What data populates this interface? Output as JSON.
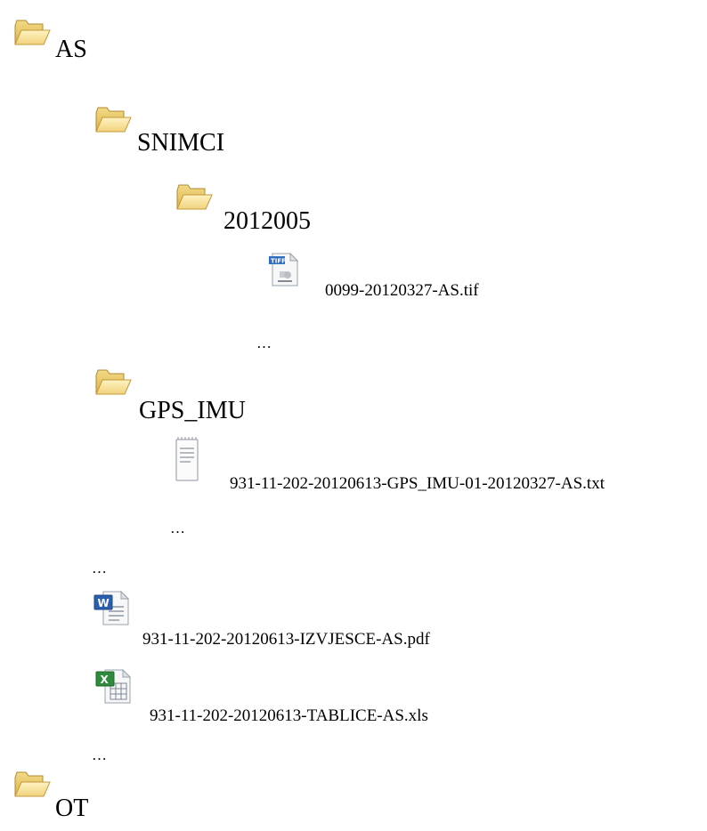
{
  "tree": {
    "root_as": {
      "label": "AS",
      "icon": "folder-icon"
    },
    "snimci": {
      "label": "SNIMCI",
      "icon": "folder-icon"
    },
    "folder_2012005": {
      "label": "2012005",
      "icon": "folder-icon"
    },
    "tif_file": {
      "label": "0099-20120327-AS.tif",
      "icon": "tiff-file-icon"
    },
    "ellipsis_2012005": "…",
    "gps_imu": {
      "label": "GPS_IMU",
      "icon": "folder-icon"
    },
    "txt_file": {
      "label": "931-11-202-20120613-GPS_IMU-01-20120327-AS.txt",
      "icon": "text-file-icon"
    },
    "ellipsis_gps": "…",
    "ellipsis_as_1": "…",
    "izvjesce_file": {
      "label": "931-11-202-20120613-IZVJESCE-AS.pdf",
      "icon": "word-document-icon"
    },
    "tablice_file": {
      "label": "931-11-202-20120613-TABLICE-AS.xls",
      "icon": "excel-spreadsheet-icon"
    },
    "ellipsis_as_2": "…",
    "root_ot": {
      "label": "OT",
      "icon": "folder-icon"
    }
  }
}
